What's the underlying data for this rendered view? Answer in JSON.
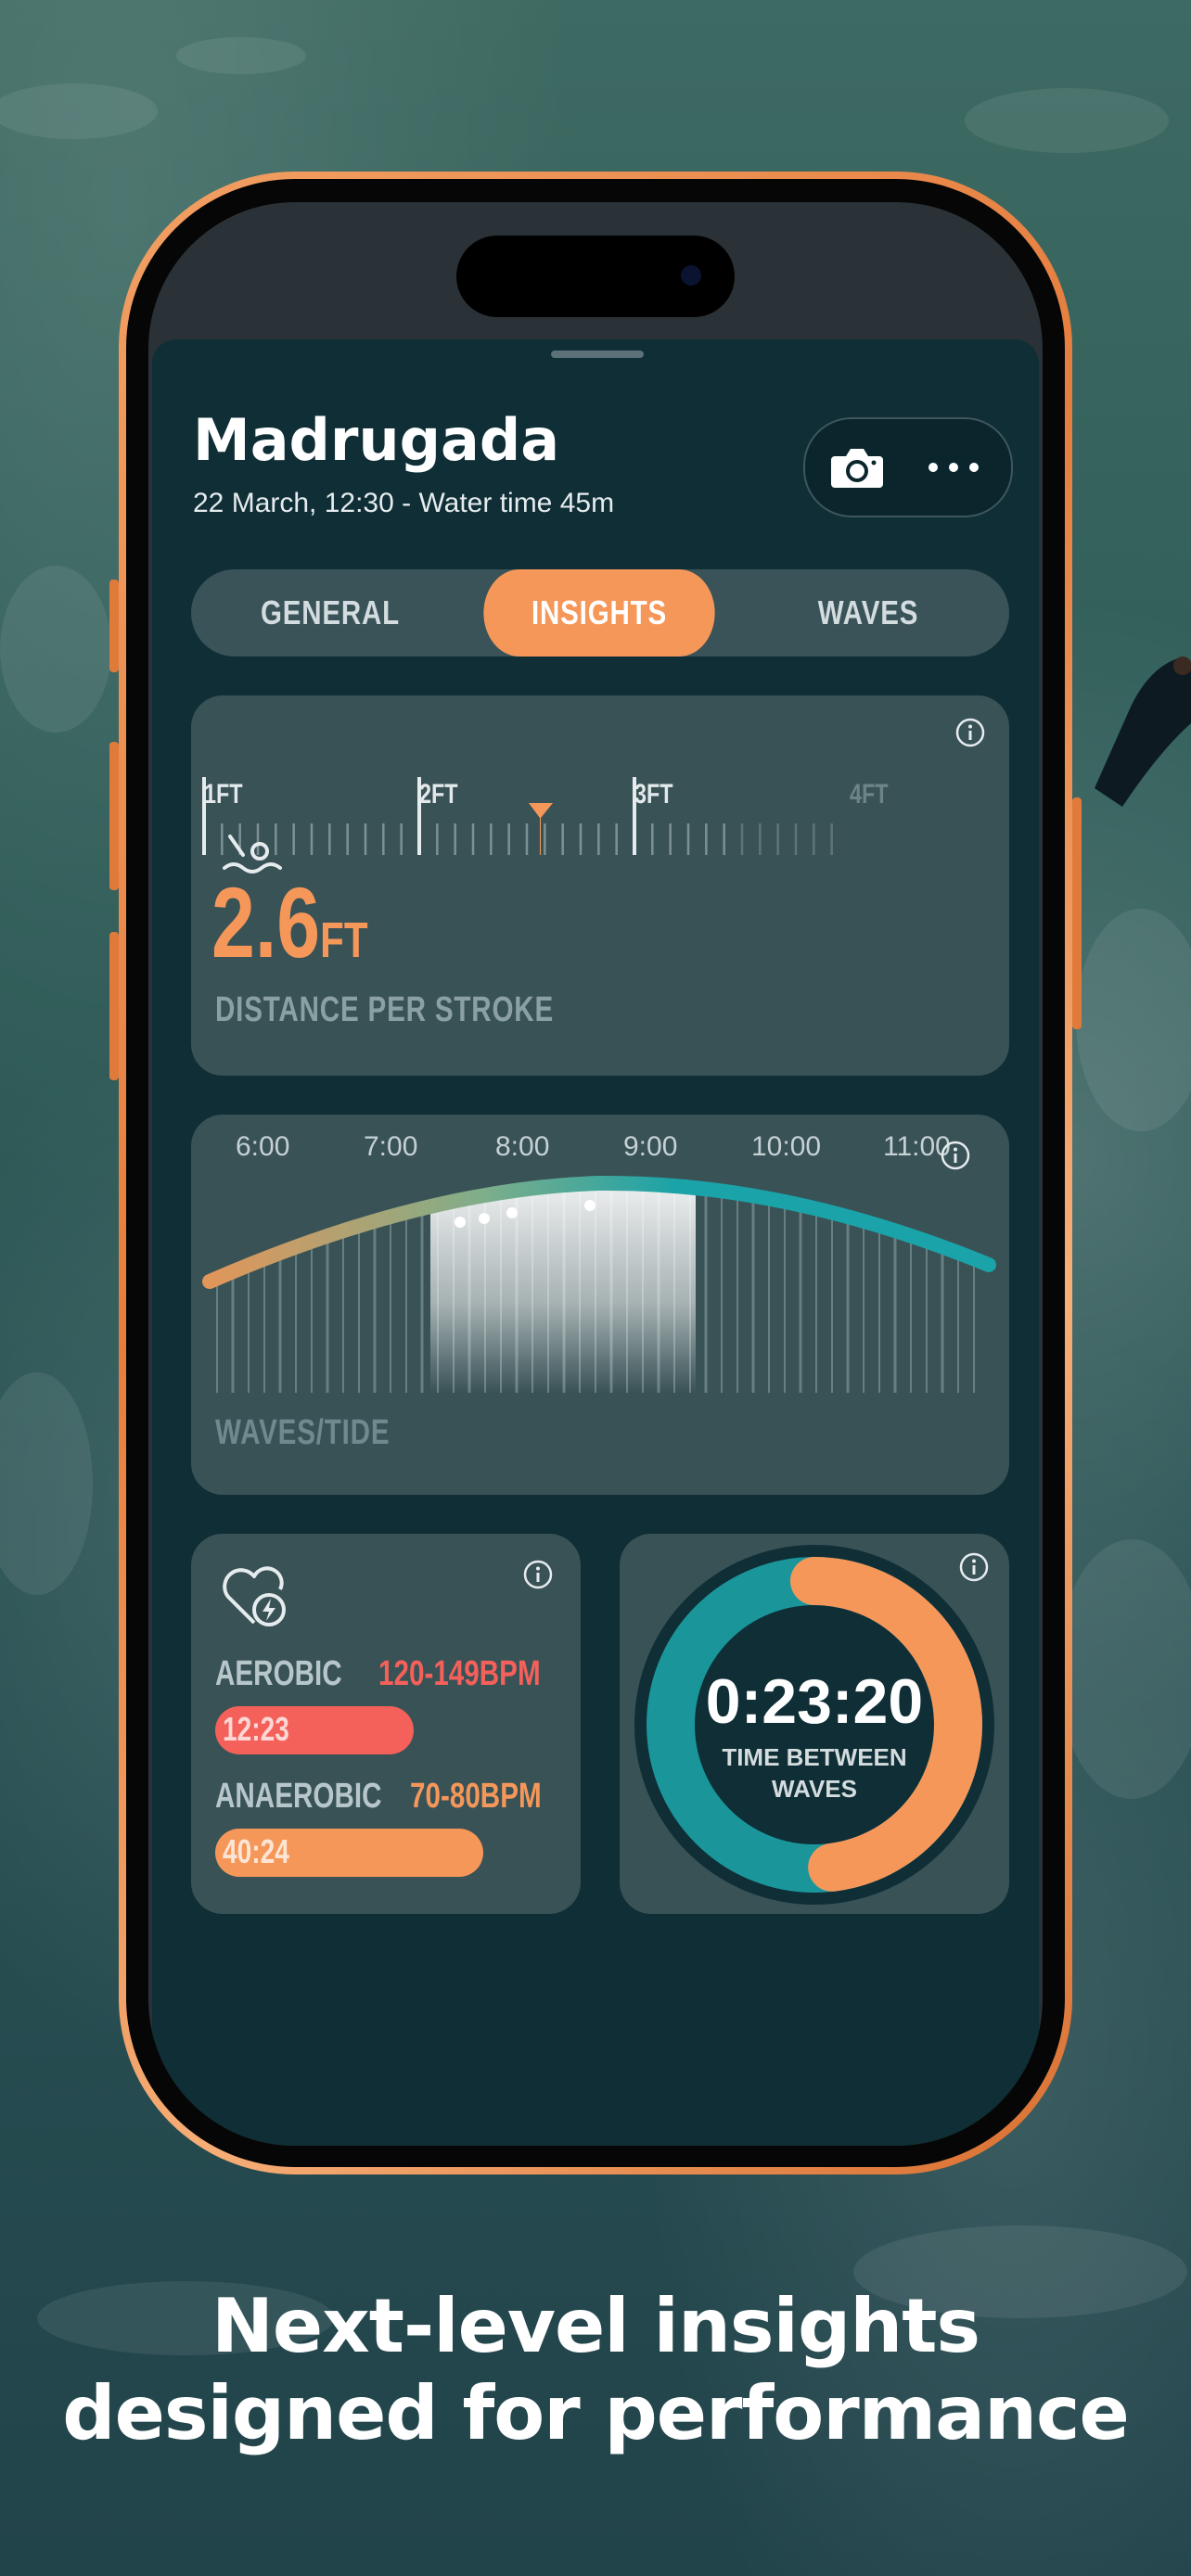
{
  "session": {
    "title": "Madrugada",
    "subtitle": "22 March, 12:30 - Water time 45m"
  },
  "tabs": [
    {
      "label": "GENERAL",
      "active": false
    },
    {
      "label": "INSIGHTS",
      "active": true
    },
    {
      "label": "WAVES",
      "active": false
    }
  ],
  "distance_card": {
    "scale_labels": [
      "1FT",
      "2FT",
      "3FT",
      "4FT"
    ],
    "value": "2.6",
    "unit": "FT",
    "value_number": 2.6,
    "label": "DISTANCE PER STROKE",
    "icon": "swimmer-icon"
  },
  "tide_card": {
    "times": [
      "6:00",
      "7:00",
      "8:00",
      "9:00",
      "10:00",
      "11:00"
    ],
    "label": "WAVES/TIDE"
  },
  "heart_card": {
    "icon": "heart-bolt-icon",
    "zones": [
      {
        "name": "AEROBIC",
        "range": "120-149BPM",
        "time": "12:23",
        "color": "#f4605a",
        "fraction": 0.63
      },
      {
        "name": "ANAEROBIC",
        "range": "70-80BPM",
        "time": "40:24",
        "color": "#f6975a",
        "fraction": 0.85
      }
    ]
  },
  "timer_card": {
    "time": "0:23:20",
    "caption_line1": "TIME BETWEEN",
    "caption_line2": "WAVES",
    "fraction": 0.48
  },
  "headline": {
    "line1": "Next-level insights",
    "line2": "designed for performance"
  },
  "colors": {
    "accent": "#f6975a",
    "aerobic": "#f4605a",
    "teal": "#1aa3a8",
    "card": "#395256",
    "sheet": "#0f2e36"
  }
}
